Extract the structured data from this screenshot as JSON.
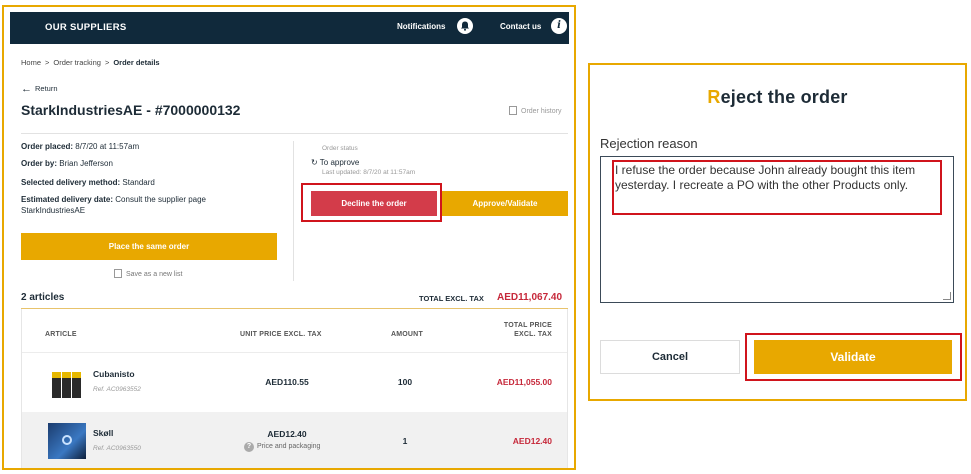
{
  "topbar": {
    "brand": "OUR SUPPLIERS",
    "notifications_label": "Notifications",
    "contact_label": "Contact us",
    "bell_icon": "bell-icon",
    "info_icon": "info-icon"
  },
  "breadcrumb": {
    "items": [
      "Home",
      "Order tracking",
      "Order details"
    ],
    "separator": ">"
  },
  "return_label": "Return",
  "order": {
    "title": "StarkIndustriesAE - #7000000132",
    "history_label": "Order history",
    "placed_label": "Order placed:",
    "placed_value": "8/7/20 at 11:57am",
    "by_label": "Order by:",
    "by_value": "Brian Jefferson",
    "delivery_method_label": "Selected delivery method:",
    "delivery_method_value": "Standard",
    "delivery_date_label": "Estimated delivery date:",
    "delivery_date_value": "Consult the supplier page StarkIndustriesAE",
    "place_same_label": "Place the same order",
    "save_list_label": "Save as a new list"
  },
  "status": {
    "title": "Order status",
    "value": "To approve",
    "last_updated": "Last updated: 8/7/20 at 11:57am"
  },
  "actions": {
    "decline_label": "Decline the order",
    "approve_label": "Approve/Validate"
  },
  "summary": {
    "articles_count": "2 articles",
    "total_label": "TOTAL EXCL. TAX",
    "total_value": "AED11,067.40"
  },
  "table": {
    "headers": {
      "article": "ARTICLE",
      "unit_price": "UNIT PRICE EXCL. TAX",
      "amount": "AMOUNT",
      "total_line1": "TOTAL PRICE",
      "total_line2": "EXCL. TAX"
    },
    "rows": [
      {
        "name": "Cubanisto",
        "ref": "Ref. AC0963552",
        "unit_price": "AED110.55",
        "amount": "100",
        "total": "AED11,055.00"
      },
      {
        "name": "Skøll",
        "ref": "Ref. AC0963550",
        "unit_price": "AED12.40",
        "packaging": "Price and packaging",
        "amount": "1",
        "total": "AED12.40"
      }
    ]
  },
  "modal": {
    "title_first": "R",
    "title_rest": "eject the order",
    "reason_label": "Rejection reason",
    "reason_text": "I refuse the order because John already bought this item yesterday. I recreate a PO with the other Products only.",
    "cancel_label": "Cancel",
    "validate_label": "Validate"
  },
  "colors": {
    "navy": "#10293b",
    "accent": "#e8a800",
    "decline": "#d33c4a",
    "price_red": "#c6283a",
    "highlight": "#d0141c"
  }
}
